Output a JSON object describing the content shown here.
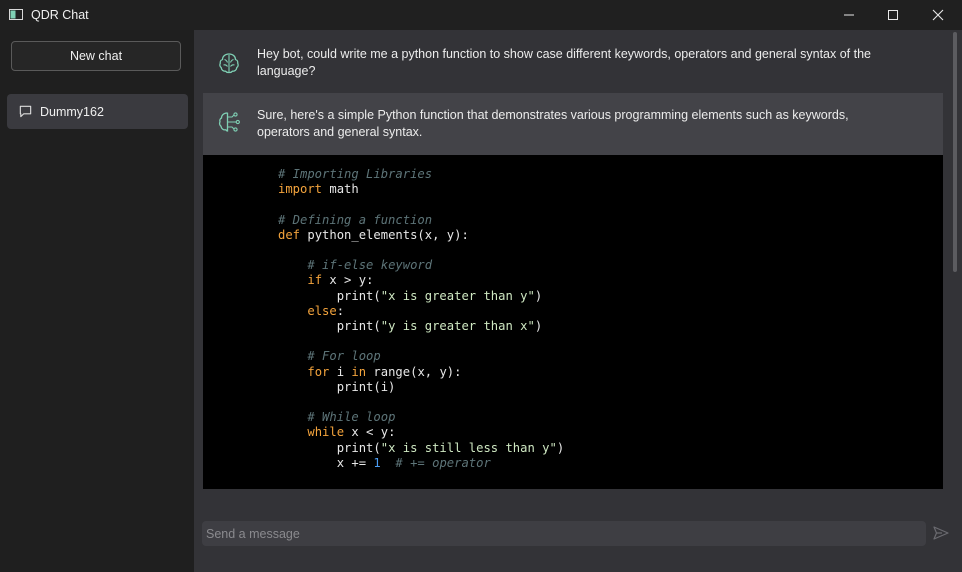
{
  "window": {
    "title": "QDR Chat"
  },
  "sidebar": {
    "new_chat_label": "New chat",
    "chats": [
      {
        "label": "Dummy162"
      }
    ]
  },
  "conversation": {
    "user_message": "Hey bot, could write me a python function to show case different keywords, operators and general syntax of the language?",
    "bot_message": "Sure, here's a simple Python function that demonstrates various programming elements such as keywords, operators and general syntax.",
    "code": {
      "language": "python",
      "lines": [
        "# Importing Libraries",
        "import math",
        "",
        "# Defining a function",
        "def python_elements(x, y):",
        "",
        "    # if-else keyword",
        "    if x > y:",
        "        print(\"x is greater than y\")",
        "    else:",
        "        print(\"y is greater than x\")",
        "",
        "    # For loop",
        "    for i in range(x, y):",
        "        print(i)",
        "",
        "    # While loop",
        "    while x < y:",
        "        print(\"x is still less than y\")",
        "        x += 1  # += operator"
      ]
    }
  },
  "composer": {
    "placeholder": "Send a message"
  },
  "colors": {
    "background": "#202020",
    "main_panel": "#333337",
    "bot_message_bg": "#434348",
    "code_bg": "#000000",
    "keyword": "#f3a33c",
    "comment": "#5d7478",
    "string": "#cfe8c2",
    "number": "#4a9cf3",
    "avatar": "#7fd0b4"
  }
}
